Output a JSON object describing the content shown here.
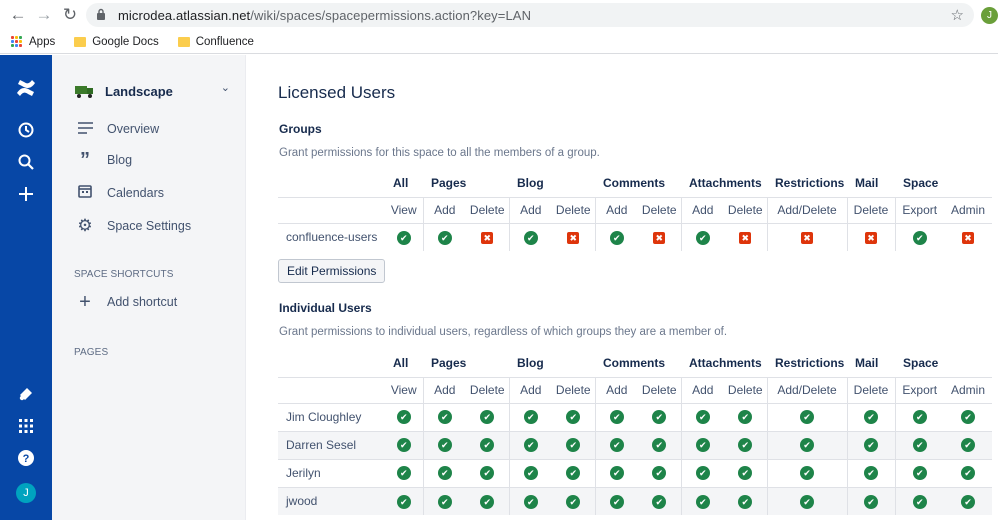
{
  "browser": {
    "url_host": "microdea.atlassian.net",
    "url_path": "/wiki/spaces/spacepermissions.action?key=LAN",
    "bookmarks": [
      {
        "label": "Apps",
        "icon": "apps-grid-icon"
      },
      {
        "label": "Google Docs",
        "icon": "folder-icon"
      },
      {
        "label": "Confluence",
        "icon": "folder-icon"
      }
    ],
    "profile_initial": "J"
  },
  "rail": {
    "icons": [
      "confluence-logo-icon",
      "recent-icon",
      "search-icon",
      "create-icon",
      "notifications-icon",
      "app-switcher-icon",
      "help-icon"
    ],
    "avatar_initial": "J"
  },
  "sidebar": {
    "space_name": "Landscape",
    "items": [
      {
        "label": "Overview",
        "icon": "overview-icon"
      },
      {
        "label": "Blog",
        "icon": "blog-quote-icon"
      },
      {
        "label": "Calendars",
        "icon": "calendar-icon"
      },
      {
        "label": "Space Settings",
        "icon": "gear-icon"
      }
    ],
    "shortcuts_heading": "SPACE SHORTCUTS",
    "add_shortcut": "Add shortcut",
    "pages_heading": "PAGES"
  },
  "main": {
    "title": "Licensed Users",
    "groups_heading": "Groups",
    "groups_desc": "Grant permissions for this space to all the members of a group.",
    "edit_button": "Edit Permissions",
    "users_heading": "Individual Users",
    "users_desc": "Grant permissions to individual users, regardless of which groups they are a member of.",
    "column_groups": [
      "All",
      "Pages",
      "Blog",
      "Comments",
      "Attachments",
      "Restrictions",
      "Mail",
      "Space"
    ],
    "column_subs": [
      "View",
      "Add",
      "Delete",
      "Add",
      "Delete",
      "Add",
      "Delete",
      "Add",
      "Delete",
      "Add/Delete",
      "Delete",
      "Export",
      "Admin"
    ],
    "groups": [
      {
        "name": "confluence-users",
        "perms": [
          true,
          true,
          false,
          true,
          false,
          true,
          false,
          true,
          false,
          false,
          false,
          true,
          false
        ]
      }
    ],
    "users": [
      {
        "name": "Jim Cloughley",
        "perms": [
          true,
          true,
          true,
          true,
          true,
          true,
          true,
          true,
          true,
          true,
          true,
          true,
          true
        ]
      },
      {
        "name": "Darren Sesel",
        "perms": [
          true,
          true,
          true,
          true,
          true,
          true,
          true,
          true,
          true,
          true,
          true,
          true,
          true
        ]
      },
      {
        "name": "Jerilyn",
        "perms": [
          true,
          true,
          true,
          true,
          true,
          true,
          true,
          true,
          true,
          true,
          true,
          true,
          true
        ]
      },
      {
        "name": "jwood",
        "perms": [
          true,
          true,
          true,
          true,
          true,
          true,
          true,
          true,
          true,
          true,
          true,
          true,
          true
        ]
      }
    ]
  },
  "colors": {
    "rail": "#0747a6",
    "granted": "#1e8449",
    "denied": "#de350b"
  }
}
